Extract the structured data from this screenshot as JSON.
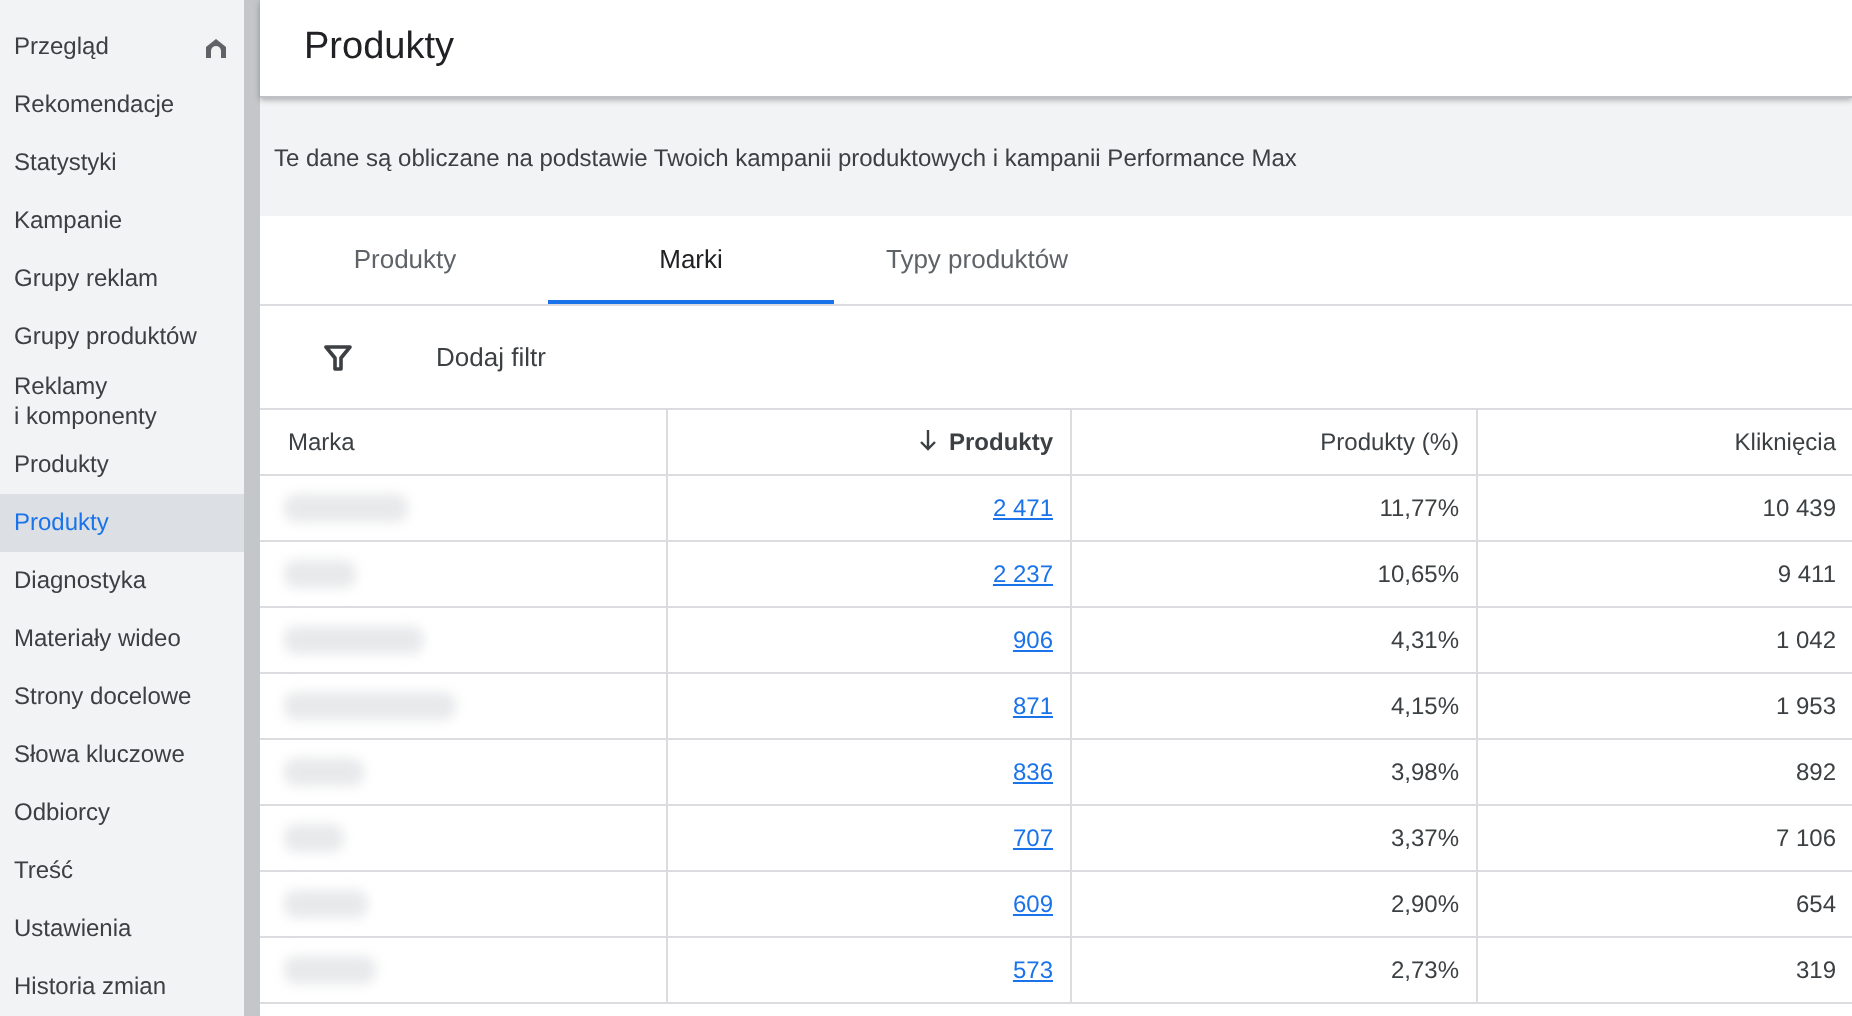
{
  "sidebar": {
    "items": [
      {
        "label": "Przegląd",
        "selected": false,
        "home": true
      },
      {
        "label": "Rekomendacje",
        "selected": false
      },
      {
        "label": "Statystyki",
        "selected": false
      },
      {
        "label": "Kampanie",
        "selected": false
      },
      {
        "label": "Grupy reklam",
        "selected": false
      },
      {
        "label": "Grupy produktów",
        "selected": false
      },
      {
        "label": "Reklamy\ni komponenty",
        "selected": false
      },
      {
        "label": "Produkty",
        "selected": false
      },
      {
        "label": "Produkty",
        "selected": true
      },
      {
        "label": "Diagnostyka",
        "selected": false
      },
      {
        "label": "Materiały wideo",
        "selected": false
      },
      {
        "label": "Strony docelowe",
        "selected": false
      },
      {
        "label": "Słowa kluczowe",
        "selected": false
      },
      {
        "label": "Odbiorcy",
        "selected": false
      },
      {
        "label": "Treść",
        "selected": false
      },
      {
        "label": "Ustawienia",
        "selected": false
      },
      {
        "label": "Historia zmian",
        "selected": false
      }
    ]
  },
  "page_title": "Produkty",
  "info_banner": "Te dane są obliczane na podstawie Twoich kampanii produktowych i kampanii Performance Max",
  "tabs": [
    {
      "label": "Produkty",
      "selected": false
    },
    {
      "label": "Marki",
      "selected": true
    },
    {
      "label": "Typy produktów",
      "selected": false
    }
  ],
  "filter": {
    "label": "Dodaj filtr"
  },
  "table": {
    "columns": [
      {
        "label": "Marka",
        "sorted": false
      },
      {
        "label": "Produkty",
        "sorted": true
      },
      {
        "label": "Produkty (%)",
        "sorted": false
      },
      {
        "label": "Kliknięcia",
        "sorted": false
      }
    ],
    "rows": [
      {
        "products": "2 471",
        "share": "11,77%",
        "clicks": "10 439"
      },
      {
        "products": "2 237",
        "share": "10,65%",
        "clicks": "9 411"
      },
      {
        "products": "906",
        "share": "4,31%",
        "clicks": "1 042"
      },
      {
        "products": "871",
        "share": "4,15%",
        "clicks": "1 953"
      },
      {
        "products": "836",
        "share": "3,98%",
        "clicks": "892"
      },
      {
        "products": "707",
        "share": "3,37%",
        "clicks": "7 106"
      },
      {
        "products": "609",
        "share": "2,90%",
        "clicks": "654"
      },
      {
        "products": "573",
        "share": "2,73%",
        "clicks": "319"
      }
    ]
  }
}
